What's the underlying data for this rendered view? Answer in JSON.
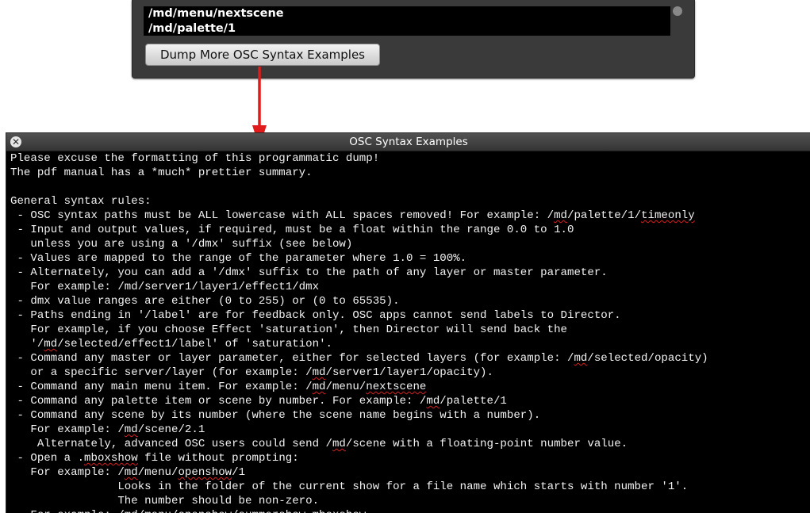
{
  "top_panel": {
    "list_items": [
      "/md/menu/nextscene",
      "/md/palette/1"
    ],
    "dump_button_label": "Dump More OSC Syntax Examples"
  },
  "window": {
    "title": "OSC Syntax Examples",
    "close_glyph": "✕",
    "lines": [
      [
        {
          "t": "Please excuse the formatting of this programmatic dump!"
        }
      ],
      [
        {
          "t": "The pdf manual has a *much* prettier summary."
        }
      ],
      [
        {
          "t": ""
        }
      ],
      [
        {
          "t": "General syntax rules:"
        }
      ],
      [
        {
          "t": " - OSC syntax paths must be ALL lowercase with ALL spaces removed! For example: /"
        },
        {
          "t": "md",
          "sq": true
        },
        {
          "t": "/palette/1/"
        },
        {
          "t": "timeonly",
          "sq": true
        }
      ],
      [
        {
          "t": " - Input and output values, if required, must be a float within the range 0.0 to 1.0"
        }
      ],
      [
        {
          "t": "   unless you are using a '/dmx' suffix (see below)"
        }
      ],
      [
        {
          "t": " - Values are mapped to the range of the parameter where 1.0 = 100%."
        }
      ],
      [
        {
          "t": " - Alternately, you can add a '/dmx' suffix to the path of any layer or master parameter."
        }
      ],
      [
        {
          "t": "   For example: /md/server1/layer1/effect1/dmx"
        }
      ],
      [
        {
          "t": " - dmx value ranges are either (0 to 255) or (0 to 65535)."
        }
      ],
      [
        {
          "t": " - Paths ending in '/label' are for feedback only. OSC apps cannot send labels to Director."
        }
      ],
      [
        {
          "t": "   For example, if you choose Effect 'saturation', then Director will send back the"
        }
      ],
      [
        {
          "t": "   '/"
        },
        {
          "t": "md",
          "sq": true
        },
        {
          "t": "/selected/effect1/label' of 'saturation'."
        }
      ],
      [
        {
          "t": " - Command any master or layer parameter, either for selected layers (for example: /"
        },
        {
          "t": "md",
          "sq": true
        },
        {
          "t": "/selected/opacity)"
        }
      ],
      [
        {
          "t": "   or a specific server/layer (for example: /"
        },
        {
          "t": "md",
          "sq": true
        },
        {
          "t": "/server1/layer1/opacity)."
        }
      ],
      [
        {
          "t": " - Command any main menu item. For example: /"
        },
        {
          "t": "md",
          "sq": true
        },
        {
          "t": "/menu/"
        },
        {
          "t": "nextscene",
          "sq": true
        }
      ],
      [
        {
          "t": " - Command any palette item or scene by number. For example: /"
        },
        {
          "t": "md",
          "sq": true
        },
        {
          "t": "/palette/1"
        }
      ],
      [
        {
          "t": " - Command any scene by its number (where the scene name begins with a number)."
        }
      ],
      [
        {
          "t": "   For example: /"
        },
        {
          "t": "md",
          "sq": true
        },
        {
          "t": "/scene/2.1"
        }
      ],
      [
        {
          "t": "    Alternately, advanced OSC users could send /"
        },
        {
          "t": "md",
          "sq": true
        },
        {
          "t": "/scene with a floating-point number value."
        }
      ],
      [
        {
          "t": " - Open a ."
        },
        {
          "t": "mboxshow",
          "sq": true
        },
        {
          "t": " file without prompting:"
        }
      ],
      [
        {
          "t": "   For example: /"
        },
        {
          "t": "md",
          "sq": true
        },
        {
          "t": "/menu/"
        },
        {
          "t": "openshow",
          "sq": true
        },
        {
          "t": "/1"
        }
      ],
      [
        {
          "t": "                Looks in the folder of the current show for a file name which starts with number '1'."
        }
      ],
      [
        {
          "t": "                The number should be non-zero."
        }
      ],
      [
        {
          "t": "   For example: /md/menu/openshow/summershow.mboxshow"
        }
      ]
    ]
  },
  "colors": {
    "arrow": "#e01b1b",
    "panel": "#3a3a3a",
    "terminal_bg": "#000000",
    "spell_underline": "#d82020"
  }
}
